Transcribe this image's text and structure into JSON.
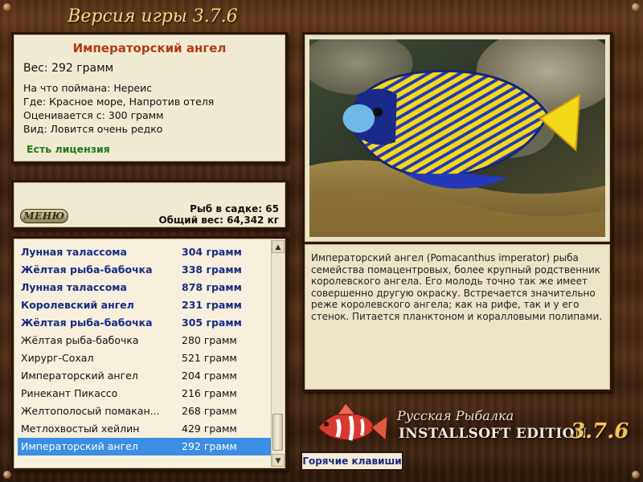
{
  "header": {
    "version_title": "Версия игры 3.7.6"
  },
  "fish_card": {
    "name": "Императорский ангел",
    "weight": "Вес: 292 грамм",
    "caught_on": "На что поймана: Нереис",
    "location": "Где: Красное море, Напротив отеля",
    "valued_from": "Оценивается с: 300 грамм",
    "rarity": "Вид: Ловится очень редко",
    "license": "Есть лицензия"
  },
  "stats": {
    "menu_label": "МЕНЮ",
    "fish_in_cage": "Рыб в садке: 65",
    "total_weight": "Общий вес: 64,342 кг"
  },
  "catch_list": [
    {
      "name": "Лунная талассома",
      "weight": "304 грамм",
      "bold": true,
      "selected": false
    },
    {
      "name": "Жёлтая рыба-бабочка",
      "weight": "338 грамм",
      "bold": true,
      "selected": false
    },
    {
      "name": "Лунная талассома",
      "weight": "878 грамм",
      "bold": true,
      "selected": false
    },
    {
      "name": "Королевский ангел",
      "weight": "231 грамм",
      "bold": true,
      "selected": false
    },
    {
      "name": "Жёлтая рыба-бабочка",
      "weight": "305 грамм",
      "bold": true,
      "selected": false
    },
    {
      "name": "Жёлтая рыба-бабочка",
      "weight": "280 грамм",
      "bold": false,
      "selected": false
    },
    {
      "name": "Хирург-Сохал",
      "weight": "521 грамм",
      "bold": false,
      "selected": false
    },
    {
      "name": "Императорский ангел",
      "weight": "204 грамм",
      "bold": false,
      "selected": false
    },
    {
      "name": "Ринекант Пикассо",
      "weight": "216 грамм",
      "bold": false,
      "selected": false
    },
    {
      "name": "Желтополосый помакан...",
      "weight": "268 грамм",
      "bold": false,
      "selected": false
    },
    {
      "name": "Метлохвостый хейлин",
      "weight": "429 грамм",
      "bold": false,
      "selected": false
    },
    {
      "name": "Императорский ангел",
      "weight": "292 грамм",
      "bold": false,
      "selected": true
    }
  ],
  "description": "Императорский ангел (Pomacanthus imperator) рыба семейства помацентровых, более крупный родственник королевского ангела. Его молодь точно так же имеет совершенно другую окраску. Встречается значительно реже королевского ангела; как на рифе, так и у его стенок. Питается планктоном и коралловыми полипами.",
  "logo": {
    "line1": "Русская Рыбалка",
    "line2": "INSTALLSOFT EDITION",
    "version": "3.7.6"
  },
  "hotkeys_label": "Горячие клавиши",
  "colors": {
    "title_red": "#b33a10",
    "license_green": "#1b7a1b",
    "list_bold_blue": "#1b2a85",
    "selection_blue": "#3b8ee4",
    "version_gold": "#f2c45a"
  },
  "icons": [
    "scroll-up-icon",
    "scroll-down-icon",
    "fish-photo",
    "logo-fish-icon"
  ]
}
